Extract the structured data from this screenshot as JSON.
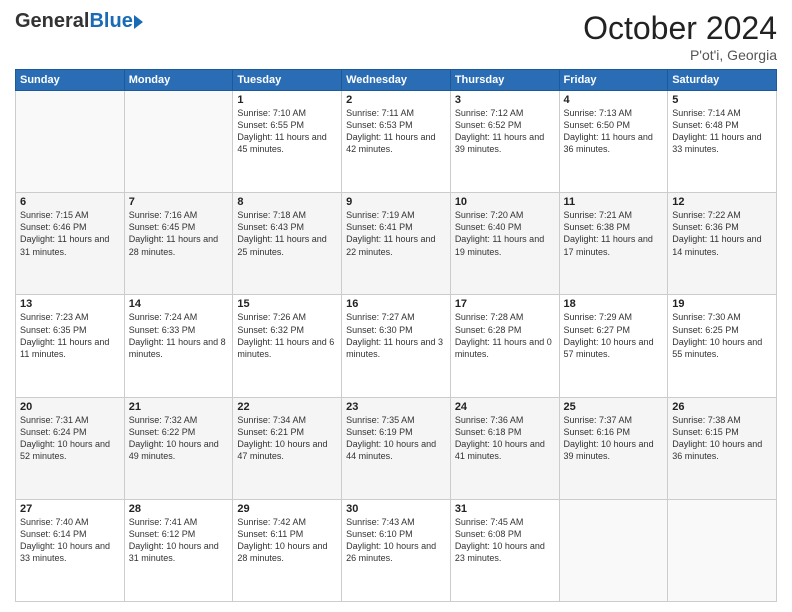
{
  "header": {
    "logo_general": "General",
    "logo_blue": "Blue",
    "month": "October 2024",
    "location": "P'ot'i, Georgia"
  },
  "days_of_week": [
    "Sunday",
    "Monday",
    "Tuesday",
    "Wednesday",
    "Thursday",
    "Friday",
    "Saturday"
  ],
  "weeks": [
    [
      {
        "day": "",
        "info": ""
      },
      {
        "day": "",
        "info": ""
      },
      {
        "day": "1",
        "info": "Sunrise: 7:10 AM\nSunset: 6:55 PM\nDaylight: 11 hours and 45 minutes."
      },
      {
        "day": "2",
        "info": "Sunrise: 7:11 AM\nSunset: 6:53 PM\nDaylight: 11 hours and 42 minutes."
      },
      {
        "day": "3",
        "info": "Sunrise: 7:12 AM\nSunset: 6:52 PM\nDaylight: 11 hours and 39 minutes."
      },
      {
        "day": "4",
        "info": "Sunrise: 7:13 AM\nSunset: 6:50 PM\nDaylight: 11 hours and 36 minutes."
      },
      {
        "day": "5",
        "info": "Sunrise: 7:14 AM\nSunset: 6:48 PM\nDaylight: 11 hours and 33 minutes."
      }
    ],
    [
      {
        "day": "6",
        "info": "Sunrise: 7:15 AM\nSunset: 6:46 PM\nDaylight: 11 hours and 31 minutes."
      },
      {
        "day": "7",
        "info": "Sunrise: 7:16 AM\nSunset: 6:45 PM\nDaylight: 11 hours and 28 minutes."
      },
      {
        "day": "8",
        "info": "Sunrise: 7:18 AM\nSunset: 6:43 PM\nDaylight: 11 hours and 25 minutes."
      },
      {
        "day": "9",
        "info": "Sunrise: 7:19 AM\nSunset: 6:41 PM\nDaylight: 11 hours and 22 minutes."
      },
      {
        "day": "10",
        "info": "Sunrise: 7:20 AM\nSunset: 6:40 PM\nDaylight: 11 hours and 19 minutes."
      },
      {
        "day": "11",
        "info": "Sunrise: 7:21 AM\nSunset: 6:38 PM\nDaylight: 11 hours and 17 minutes."
      },
      {
        "day": "12",
        "info": "Sunrise: 7:22 AM\nSunset: 6:36 PM\nDaylight: 11 hours and 14 minutes."
      }
    ],
    [
      {
        "day": "13",
        "info": "Sunrise: 7:23 AM\nSunset: 6:35 PM\nDaylight: 11 hours and 11 minutes."
      },
      {
        "day": "14",
        "info": "Sunrise: 7:24 AM\nSunset: 6:33 PM\nDaylight: 11 hours and 8 minutes."
      },
      {
        "day": "15",
        "info": "Sunrise: 7:26 AM\nSunset: 6:32 PM\nDaylight: 11 hours and 6 minutes."
      },
      {
        "day": "16",
        "info": "Sunrise: 7:27 AM\nSunset: 6:30 PM\nDaylight: 11 hours and 3 minutes."
      },
      {
        "day": "17",
        "info": "Sunrise: 7:28 AM\nSunset: 6:28 PM\nDaylight: 11 hours and 0 minutes."
      },
      {
        "day": "18",
        "info": "Sunrise: 7:29 AM\nSunset: 6:27 PM\nDaylight: 10 hours and 57 minutes."
      },
      {
        "day": "19",
        "info": "Sunrise: 7:30 AM\nSunset: 6:25 PM\nDaylight: 10 hours and 55 minutes."
      }
    ],
    [
      {
        "day": "20",
        "info": "Sunrise: 7:31 AM\nSunset: 6:24 PM\nDaylight: 10 hours and 52 minutes."
      },
      {
        "day": "21",
        "info": "Sunrise: 7:32 AM\nSunset: 6:22 PM\nDaylight: 10 hours and 49 minutes."
      },
      {
        "day": "22",
        "info": "Sunrise: 7:34 AM\nSunset: 6:21 PM\nDaylight: 10 hours and 47 minutes."
      },
      {
        "day": "23",
        "info": "Sunrise: 7:35 AM\nSunset: 6:19 PM\nDaylight: 10 hours and 44 minutes."
      },
      {
        "day": "24",
        "info": "Sunrise: 7:36 AM\nSunset: 6:18 PM\nDaylight: 10 hours and 41 minutes."
      },
      {
        "day": "25",
        "info": "Sunrise: 7:37 AM\nSunset: 6:16 PM\nDaylight: 10 hours and 39 minutes."
      },
      {
        "day": "26",
        "info": "Sunrise: 7:38 AM\nSunset: 6:15 PM\nDaylight: 10 hours and 36 minutes."
      }
    ],
    [
      {
        "day": "27",
        "info": "Sunrise: 7:40 AM\nSunset: 6:14 PM\nDaylight: 10 hours and 33 minutes."
      },
      {
        "day": "28",
        "info": "Sunrise: 7:41 AM\nSunset: 6:12 PM\nDaylight: 10 hours and 31 minutes."
      },
      {
        "day": "29",
        "info": "Sunrise: 7:42 AM\nSunset: 6:11 PM\nDaylight: 10 hours and 28 minutes."
      },
      {
        "day": "30",
        "info": "Sunrise: 7:43 AM\nSunset: 6:10 PM\nDaylight: 10 hours and 26 minutes."
      },
      {
        "day": "31",
        "info": "Sunrise: 7:45 AM\nSunset: 6:08 PM\nDaylight: 10 hours and 23 minutes."
      },
      {
        "day": "",
        "info": ""
      },
      {
        "day": "",
        "info": ""
      }
    ]
  ]
}
